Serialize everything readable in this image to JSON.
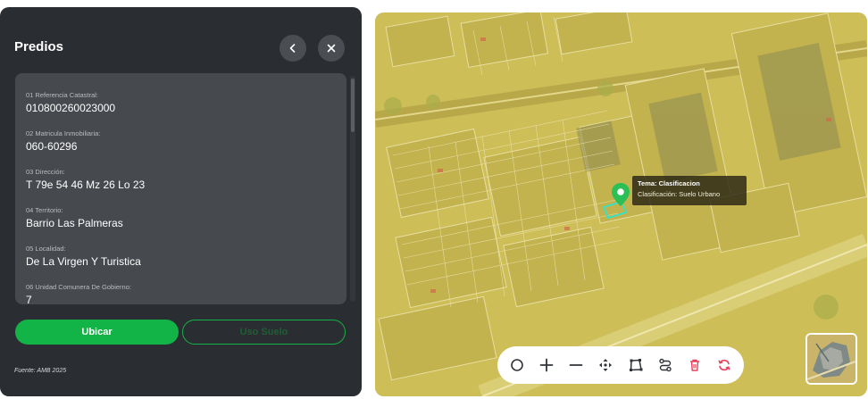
{
  "panel": {
    "title": "Predios",
    "back_icon": "chevron-left-icon",
    "close_icon": "close-icon"
  },
  "fields": [
    {
      "label": "01 Referencia Catastral:",
      "value": "010800260023000"
    },
    {
      "label": "02 Matricula Inmobiliaria:",
      "value": "060-60296"
    },
    {
      "label": "03 Dirección:",
      "value": "T 79e 54 46 Mz 26 Lo 23"
    },
    {
      "label": "04 Territorio:",
      "value": "Barrio Las Palmeras"
    },
    {
      "label": "05 Localidad:",
      "value": "De La Virgen Y Turistica"
    },
    {
      "label": "06 Unidad Comunera De Gobierno:",
      "value": "7"
    }
  ],
  "actions": {
    "ubicar_label": "Ubicar",
    "uso_suelo_label": "Uso Suelo"
  },
  "source_note": "Fuente: AMB 2025",
  "map": {
    "tooltip_title": "Tema: Clasificacion",
    "tooltip_body": "Clasificación: Suelo Urbano",
    "toolbar_icons": [
      "circle-draw-icon",
      "zoom-in-icon",
      "zoom-out-icon",
      "pan-move-icon",
      "polygon-draw-icon",
      "route-icon",
      "delete-icon",
      "reset-icon"
    ]
  },
  "colors": {
    "accent": "#12b347",
    "panel_bg": "#2a2d31",
    "card_bg": "#46494e",
    "map_overlay": "#d2c35e",
    "danger": "#e8405a"
  }
}
